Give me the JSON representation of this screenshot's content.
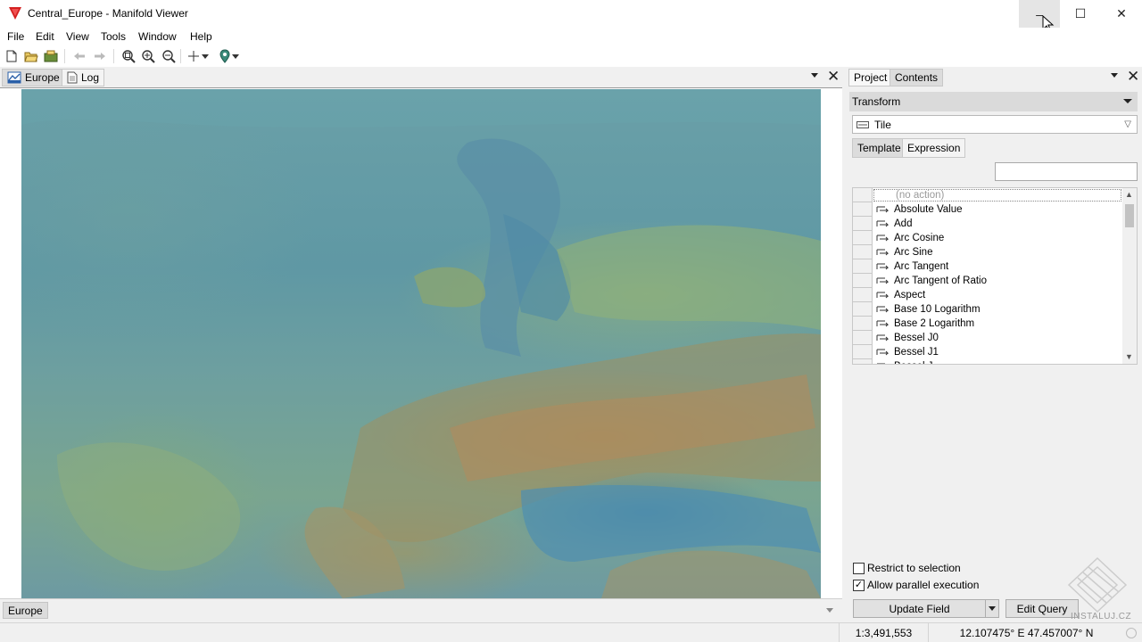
{
  "window": {
    "title": "Central_Europe - Manifold Viewer",
    "minimize_glyph": "–",
    "maximize_glyph": "☐",
    "close_glyph": "✕"
  },
  "menu": [
    "File",
    "Edit",
    "View",
    "Tools",
    "Window",
    "Help"
  ],
  "toolbar": {
    "icons": [
      "new-file-icon",
      "open-folder-icon",
      "open-project-icon",
      "back-arrow-icon",
      "forward-arrow-icon",
      "zoom-to-fit-icon",
      "zoom-in-icon",
      "zoom-out-icon",
      "pan-crosshair-icon",
      "locate-pin-icon"
    ]
  },
  "doc_tabs": [
    {
      "label": "Europe",
      "active": true
    },
    {
      "label": "Log",
      "active": false
    }
  ],
  "map": {
    "name": "Europe"
  },
  "bottom_tab": "Europe",
  "right_panel": {
    "tabs": [
      {
        "label": "Project",
        "active": true
      },
      {
        "label": "Contents",
        "active": false
      }
    ],
    "section": "Transform",
    "combo_value": "Tile",
    "subtabs": [
      {
        "label": "Template",
        "active": true
      },
      {
        "label": "Expression",
        "active": false
      }
    ],
    "filter_value": "",
    "list": {
      "no_action": "(no action)",
      "items": [
        "Absolute Value",
        "Add",
        "Arc Cosine",
        "Arc Sine",
        "Arc Tangent",
        "Arc Tangent of Ratio",
        "Aspect",
        "Base 10 Logarithm",
        "Base 2 Logarithm",
        "Bessel J0",
        "Bessel J1",
        "Bessel J..."
      ]
    },
    "checkboxes": [
      {
        "label": "Restrict to selection",
        "checked": false
      },
      {
        "label": "Allow parallel execution",
        "checked": true
      }
    ],
    "update_button": "Update Field",
    "edit_query_button": "Edit Query"
  },
  "status": {
    "scale": "1:3,491,553",
    "coords": "12.107475° E 47.457007° N"
  },
  "watermark": "INSTALUJ.CZ",
  "colors": {
    "logo_red": "#d42020",
    "active_tab": "#dcdcdc",
    "panel_bg": "#f0f0f0"
  }
}
